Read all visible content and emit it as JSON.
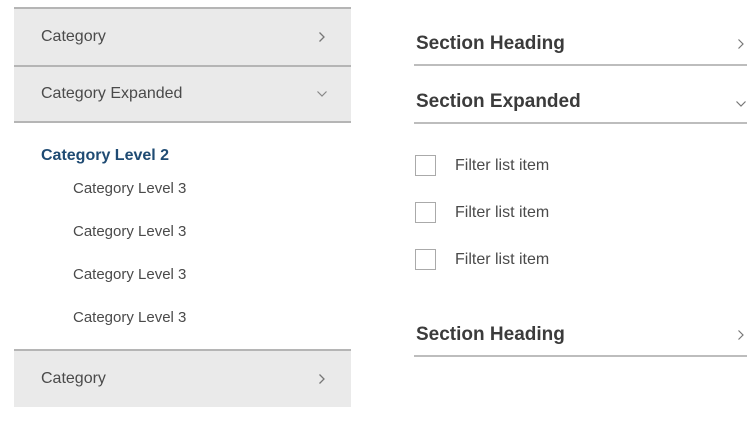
{
  "left_nav": {
    "categories_top": [
      {
        "label": "Category",
        "state": "collapsed",
        "icon": "chevron-right-icon"
      },
      {
        "label": "Category Expanded",
        "state": "expanded",
        "icon": "chevron-down-icon"
      }
    ],
    "level2": {
      "label": "Category Level 2"
    },
    "level3": [
      {
        "label": "Category Level 3"
      },
      {
        "label": "Category Level 3"
      },
      {
        "label": "Category Level 3"
      },
      {
        "label": "Category Level 3"
      }
    ],
    "categories_bottom": [
      {
        "label": "Category",
        "state": "collapsed",
        "icon": "chevron-right-icon"
      }
    ]
  },
  "filter_panel": {
    "sections": [
      {
        "title": "Section Heading",
        "state": "collapsed",
        "icon": "chevron-right-icon"
      },
      {
        "title": "Section Expanded",
        "state": "expanded",
        "icon": "chevron-down-icon"
      },
      {
        "title": "Section Heading",
        "state": "collapsed",
        "icon": "chevron-right-icon"
      }
    ],
    "filter_items": [
      {
        "label": "Filter list item",
        "checked": false
      },
      {
        "label": "Filter list item",
        "checked": false
      },
      {
        "label": "Filter list item",
        "checked": false
      }
    ]
  },
  "colors": {
    "category_bg": "#eaeaea",
    "divider": "#b5b5b5",
    "level2_text": "#1f4b73",
    "body_text": "#4a4a4a"
  }
}
